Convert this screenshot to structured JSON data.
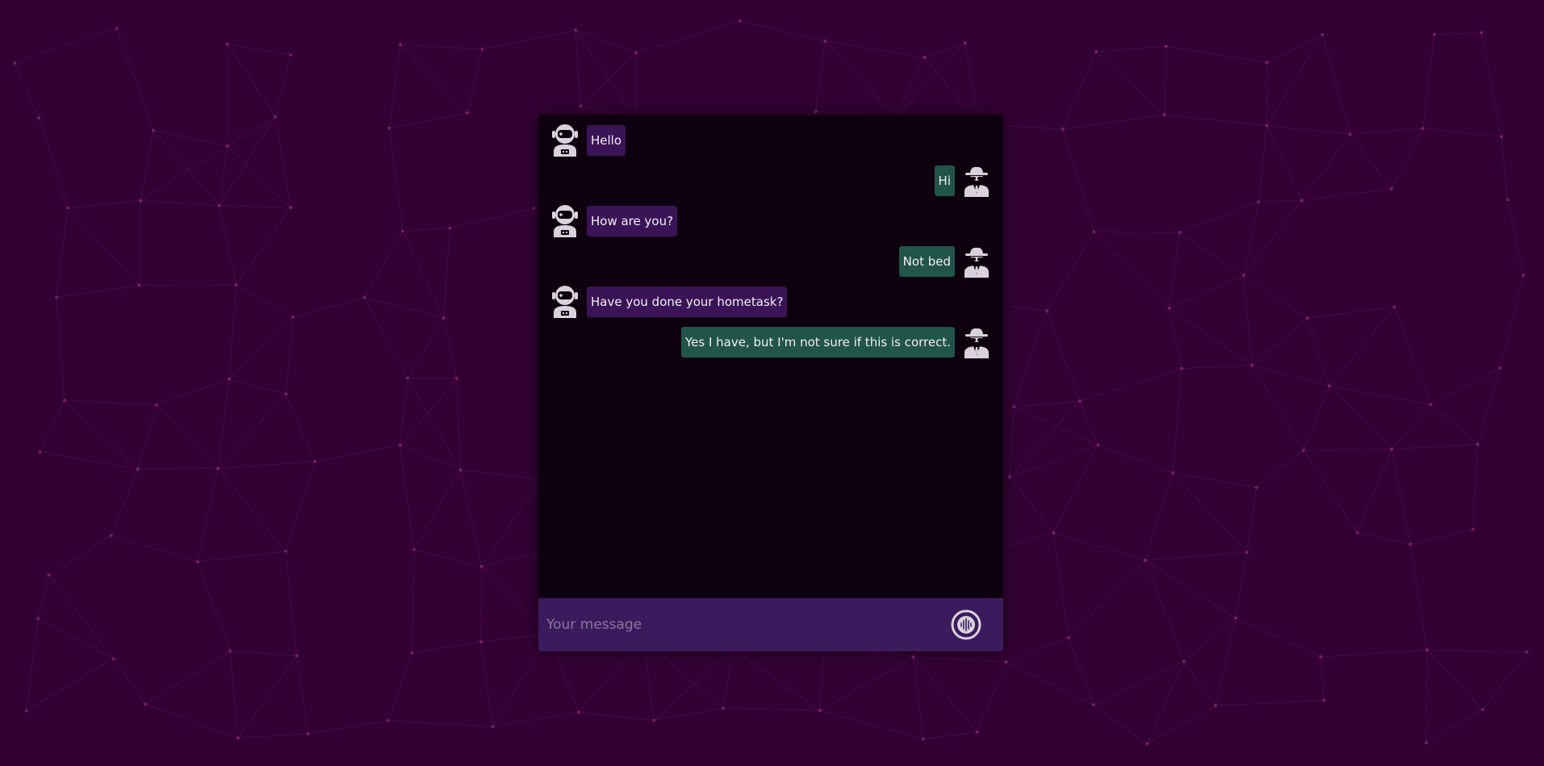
{
  "colors": {
    "background": "#330033",
    "chat_background": "#0f0010",
    "bot_bubble": "#3b1457",
    "user_bubble": "#215548",
    "composer": "#3b1b5d",
    "icon": "#d9d2dc"
  },
  "icons": {
    "bot_avatar": "astronaut-icon",
    "user_avatar": "spy-icon",
    "send": "voice-send-icon"
  },
  "messages": [
    {
      "sender": "bot",
      "text": "Hello"
    },
    {
      "sender": "user",
      "text": "Hi"
    },
    {
      "sender": "bot",
      "text": "How are you?"
    },
    {
      "sender": "user",
      "text": "Not bed"
    },
    {
      "sender": "bot",
      "text": "Have you done your hometask?"
    },
    {
      "sender": "user",
      "text": "Yes I have, but I'm not sure if this is correct."
    }
  ],
  "composer": {
    "placeholder": "Your message",
    "value": ""
  }
}
